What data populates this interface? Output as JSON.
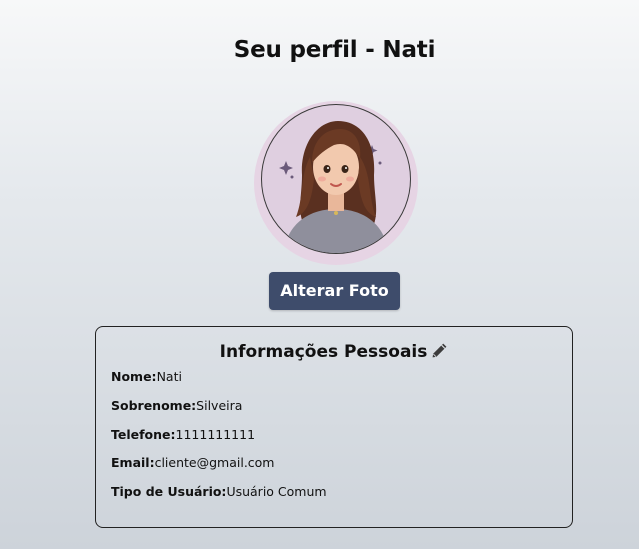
{
  "page": {
    "title": "Seu perfil - Nati"
  },
  "profile": {
    "change_photo_label": "Alterar Foto"
  },
  "info_card": {
    "title": "Informações Pessoais",
    "fields": [
      {
        "label": "Nome:",
        "value": "Nati"
      },
      {
        "label": "Sobrenome:",
        "value": "Silveira"
      },
      {
        "label": "Telefone:",
        "value": "1111111111"
      },
      {
        "label": "Email:",
        "value": "cliente@gmail.com"
      },
      {
        "label": "Tipo de Usuário:",
        "value": "Usuário Comum"
      }
    ]
  },
  "icons": {
    "edit": "pencil-icon",
    "avatar": "profile-avatar"
  },
  "colors": {
    "button_bg": "#3e4c6b",
    "button_text": "#ffffff",
    "avatar_ring": "#e6d4e4"
  }
}
